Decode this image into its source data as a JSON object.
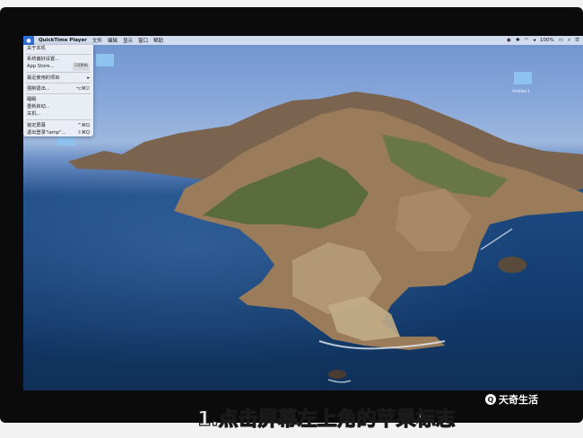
{
  "menubar": {
    "apple": "",
    "app_name": "QuickTime Player",
    "items": [
      "文件",
      "编辑",
      "显示",
      "窗口",
      "帮助"
    ],
    "right": {
      "battery": "100%"
    }
  },
  "apple_menu": {
    "items": [
      {
        "label": "关于本机",
        "shortcut": ""
      },
      {
        "label": "系统偏好设置...",
        "shortcut": ""
      },
      {
        "label": "App Store...",
        "shortcut": "",
        "badge": "1项更新"
      },
      {
        "label": "最近使用的项目",
        "shortcut": "▸"
      },
      {
        "label": "强制退出...",
        "shortcut": "⌥⌘⎋"
      },
      {
        "label": "睡眠",
        "shortcut": ""
      },
      {
        "label": "重新启动...",
        "shortcut": ""
      },
      {
        "label": "关机...",
        "shortcut": ""
      },
      {
        "label": "锁定屏幕",
        "shortcut": "^⌘Q"
      },
      {
        "label": "退出登录\"lamp\"...",
        "shortcut": "⇧⌘Q"
      }
    ]
  },
  "desktop_icons": [
    {
      "label": "Untitled 1"
    },
    {
      "label": ""
    }
  ],
  "caption": "1.点击屏幕左上角的苹果标志",
  "watermark": "天奇生活",
  "colors": {
    "accent": "#3d7ce5",
    "menubar": "#e6ebf5"
  }
}
